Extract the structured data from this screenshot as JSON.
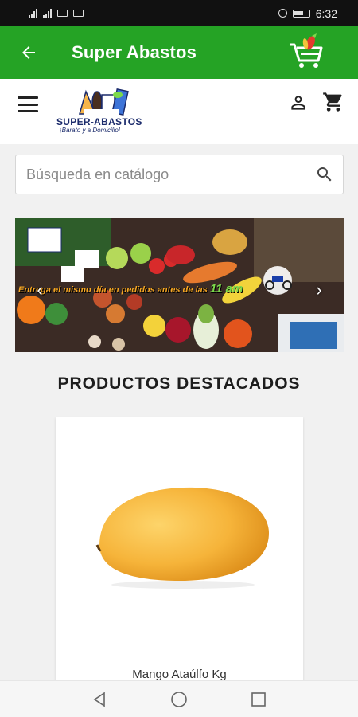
{
  "status": {
    "time": "6:32"
  },
  "app_bar": {
    "title": "Super Abastos"
  },
  "brand": {
    "name": "SUPER-ABASTOS",
    "tagline": "¡Barato y a Domicilio!"
  },
  "search": {
    "placeholder": "Búsqueda en catálogo",
    "value": ""
  },
  "banner": {
    "promo_text": "Entrega el mismo día en pedidos antes de las",
    "promo_time": "11 am"
  },
  "featured": {
    "title": "PRODUCTOS DESTACADOS"
  },
  "products": [
    {
      "name": "Mango Ataúlfo Kg"
    }
  ],
  "colors": {
    "brand_green": "#25a325",
    "title_text": "#1d1d1d"
  },
  "icons": {
    "back": "arrow-left-icon",
    "menu": "menu-icon",
    "user": "user-icon",
    "cart": "cart-icon",
    "search": "search-icon"
  }
}
